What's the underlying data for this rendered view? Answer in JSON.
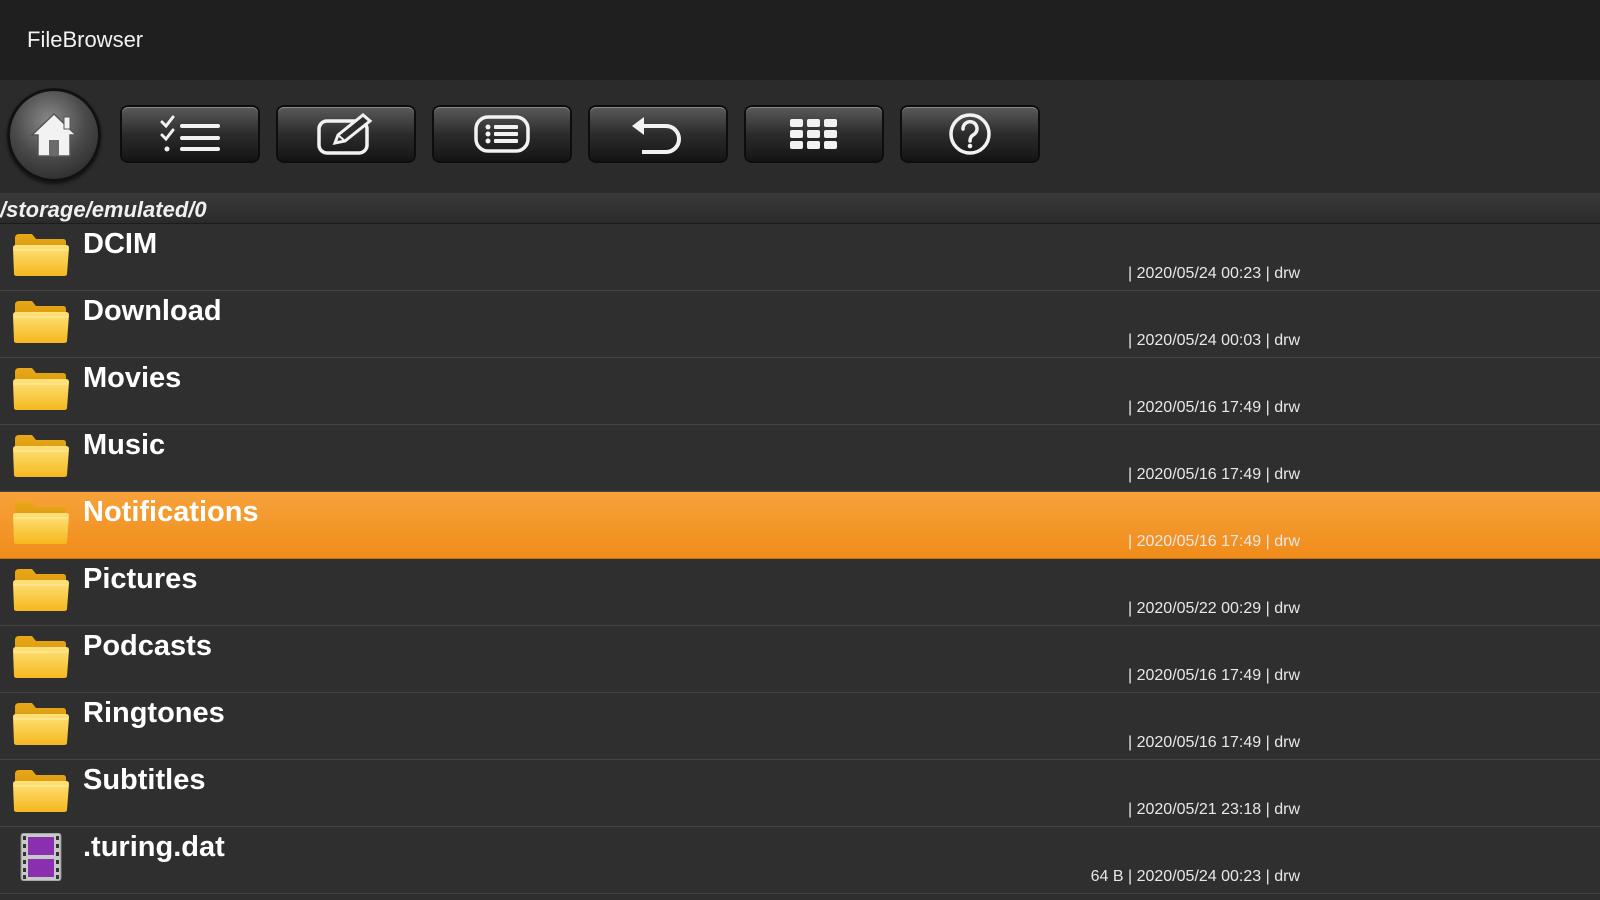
{
  "app": {
    "title": "FileBrowser"
  },
  "toolbar": {
    "buttons": [
      {
        "name": "multi-select-button",
        "icon": "checklist-icon"
      },
      {
        "name": "edit-button",
        "icon": "edit-icon"
      },
      {
        "name": "list-view-button",
        "icon": "list-icon"
      },
      {
        "name": "back-button",
        "icon": "undo-icon"
      },
      {
        "name": "grid-view-button",
        "icon": "grid-icon"
      },
      {
        "name": "help-button",
        "icon": "help-icon"
      }
    ]
  },
  "path": "/storage/emulated/0",
  "colors": {
    "accent": "#f39422",
    "folder": "#f5c327"
  },
  "files": [
    {
      "name": "DCIM",
      "meta": "| 2020/05/24 00:23 | drw",
      "type": "folder"
    },
    {
      "name": "Download",
      "meta": "| 2020/05/24 00:03 | drw",
      "type": "folder"
    },
    {
      "name": "Movies",
      "meta": "| 2020/05/16 17:49 | drw",
      "type": "folder"
    },
    {
      "name": "Music",
      "meta": "| 2020/05/16 17:49 | drw",
      "type": "folder"
    },
    {
      "name": "Notifications",
      "meta": "| 2020/05/16 17:49 | drw",
      "type": "folder",
      "selected": true
    },
    {
      "name": "Pictures",
      "meta": "| 2020/05/22 00:29 | drw",
      "type": "folder"
    },
    {
      "name": "Podcasts",
      "meta": "| 2020/05/16 17:49 | drw",
      "type": "folder"
    },
    {
      "name": "Ringtones",
      "meta": "| 2020/05/16 17:49 | drw",
      "type": "folder"
    },
    {
      "name": "Subtitles",
      "meta": "| 2020/05/21 23:18 | drw",
      "type": "folder"
    },
    {
      "name": ".turing.dat",
      "meta": "64 B | 2020/05/24 00:23 | drw",
      "type": "video-file"
    }
  ]
}
